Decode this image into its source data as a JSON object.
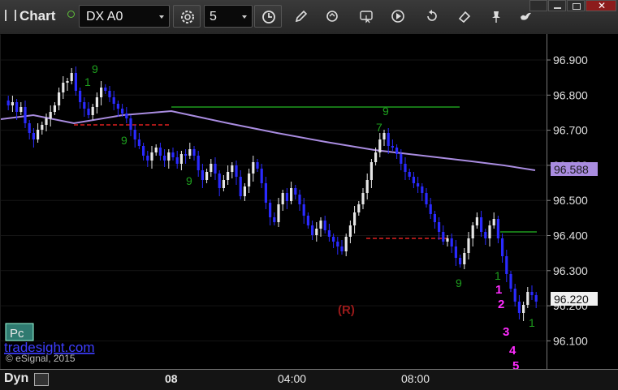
{
  "window": {
    "title": "Chart"
  },
  "toolbar": {
    "symbol": "DX A0",
    "interval": "5",
    "icons": [
      "clock-settings-icon",
      "clock-icon",
      "pencil-icon",
      "refresh-icon",
      "cursor-icon",
      "play-icon",
      "eraser-icon",
      "pin-icon",
      "bird-icon"
    ]
  },
  "colors": {
    "background": "#000000",
    "candle_up": "#e6e6e6",
    "candle_down": "#2a2aff",
    "moving_average": "#a98ce0",
    "resistance_line": "#1e9b1e",
    "support_line": "#e02020",
    "td_green": "#1ea01e",
    "td_magenta": "#ff2cff",
    "pc_box": "#2f7a70",
    "watermark": "#3d3dff"
  },
  "price_axis": {
    "labels": [
      "96.900",
      "96.800",
      "96.700",
      "96.600",
      "96.500",
      "96.400",
      "96.300",
      "96.200",
      "96.100"
    ],
    "current_price": "96.220",
    "ma_value": "96.588"
  },
  "time_axis": {
    "labels": [
      "08",
      "04:00",
      "08:00"
    ]
  },
  "annotations": {
    "reversal": "(R)",
    "setup_counts_top": [
      "9",
      "1",
      "7",
      "9",
      "9",
      "9",
      "9"
    ],
    "setup_counts_bottom": [
      "1",
      "2",
      "3",
      "4",
      "5"
    ],
    "final_count": "1"
  },
  "overlay": {
    "pc_label": "Pc",
    "watermark": "tradesight.com",
    "copyright": "© eSignal, 2015"
  },
  "bottom": {
    "label": "Dyn"
  }
}
